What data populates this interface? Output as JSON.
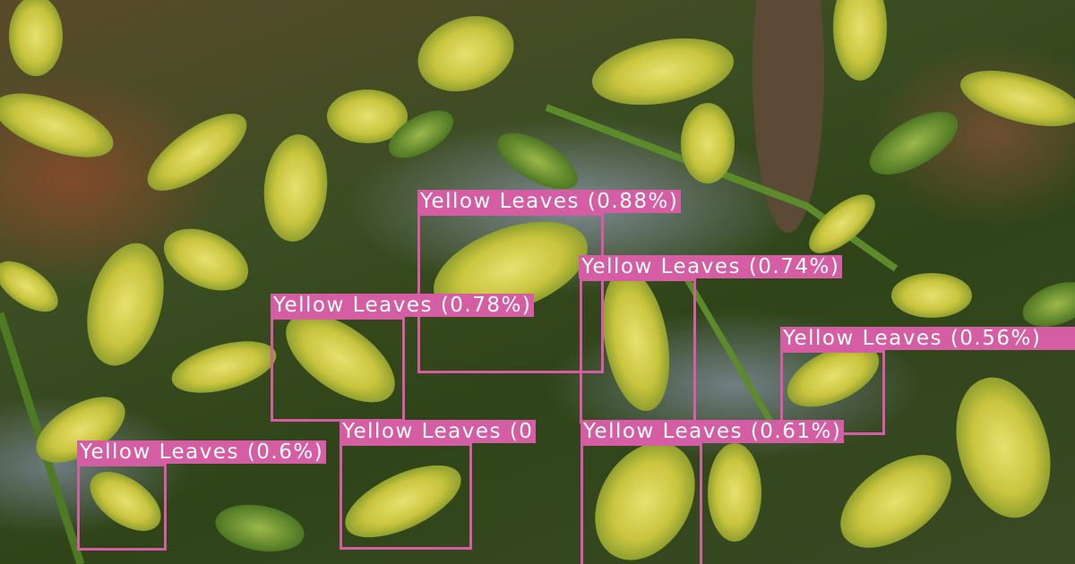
{
  "detections": [
    {
      "label": "Yellow Leaves (0.88%)"
    },
    {
      "label": "Yellow Leaves (0.74%)"
    },
    {
      "label": "Yellow Leaves (0.78%)"
    },
    {
      "label": "Yellow Leaves (0.56%)"
    },
    {
      "label": "Yellow Leaves (0"
    },
    {
      "label": "Yellow Leaves (0.61%)"
    },
    {
      "label": "Yellow Leaves (0.6%)"
    }
  ],
  "colors": {
    "box": "#d45da3",
    "label_text": "#ffffff"
  }
}
